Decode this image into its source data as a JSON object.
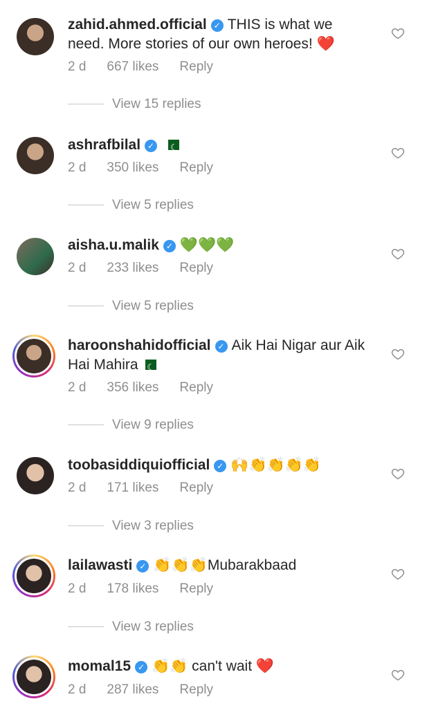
{
  "comments": [
    {
      "user": "zahid.ahmed.official",
      "verified": true,
      "text": "THIS is what we need. More stories of our own heroes! ❤️",
      "time": "2 d",
      "likes": "667 likes",
      "reply": "Reply",
      "view": "View 15 replies",
      "avatar": "avatar-male",
      "story": false
    },
    {
      "user": "ashrafbilal",
      "verified": true,
      "text": "",
      "flag": true,
      "time": "2 d",
      "likes": "350 likes",
      "reply": "Reply",
      "view": "View 5 replies",
      "avatar": "avatar-male",
      "story": false
    },
    {
      "user": "aisha.u.malik",
      "verified": true,
      "text": "💚💚💚",
      "time": "2 d",
      "likes": "233 likes",
      "reply": "Reply",
      "view": "View 5 replies",
      "avatar": "avatar-group",
      "story": false
    },
    {
      "user": "haroonshahidofficial",
      "verified": true,
      "text": "Aik Hai Nigar aur Aik Hai Mahira",
      "flag": true,
      "time": "2 d",
      "likes": "356 likes",
      "reply": "Reply",
      "view": "View 9 replies",
      "avatar": "avatar-male",
      "story": true
    },
    {
      "user": "toobasiddiquiofficial",
      "verified": true,
      "text": "🙌👏👏👏👏",
      "time": "2 d",
      "likes": "171 likes",
      "reply": "Reply",
      "view": "View 3 replies",
      "avatar": "avatar-female",
      "story": false
    },
    {
      "user": "lailawasti",
      "verified": true,
      "text": "👏👏👏Mubarakbaad",
      "time": "2 d",
      "likes": "178 likes",
      "reply": "Reply",
      "view": "View 3 replies",
      "avatar": "avatar-female",
      "story": true
    },
    {
      "user": "momal15",
      "verified": true,
      "text": "👏👏 can't wait ❤️",
      "time": "2 d",
      "likes": "287 likes",
      "reply": "Reply",
      "view": "",
      "avatar": "avatar-female",
      "story": true
    }
  ],
  "colors": {
    "text": "#262626",
    "muted": "#8e8e8e",
    "verified": "#3897f0"
  },
  "icons": {
    "like": "heart-outline-icon",
    "verified": "verified-badge-icon",
    "flag": "pakistan-flag-icon"
  }
}
